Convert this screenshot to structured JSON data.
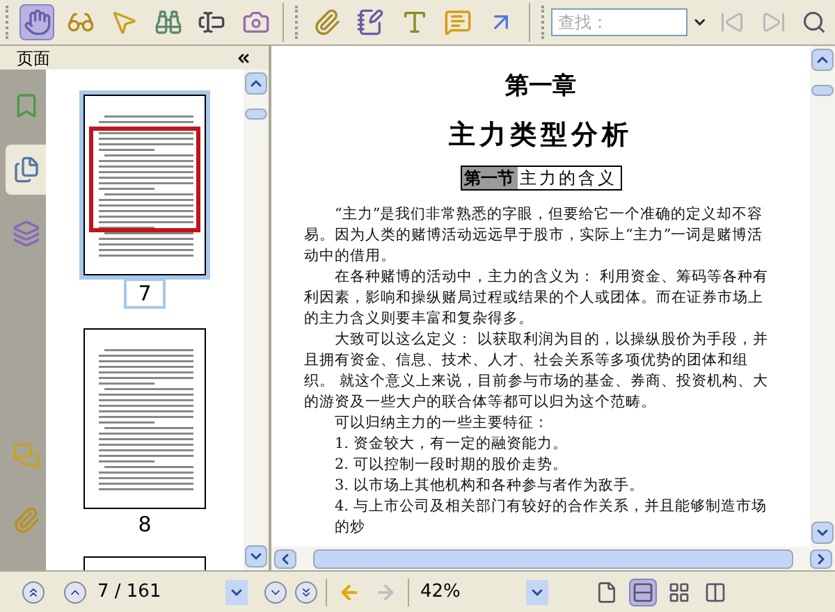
{
  "toolbar": {
    "tools": [
      {
        "kind": "hand",
        "selected": true
      },
      {
        "kind": "glasses",
        "selected": false
      },
      {
        "kind": "pointer",
        "selected": false
      },
      {
        "kind": "binoculars",
        "selected": false
      },
      {
        "kind": "text-select",
        "selected": false
      },
      {
        "kind": "camera",
        "selected": false
      },
      {
        "kind": "attach",
        "selected": false
      },
      {
        "kind": "note",
        "selected": false
      },
      {
        "kind": "textbox",
        "selected": false
      },
      {
        "kind": "comment",
        "selected": false
      },
      {
        "kind": "arrow",
        "selected": false
      }
    ],
    "search": {
      "placeholder": "查找："
    },
    "find_buttons": [
      {
        "kind": "prev",
        "disabled": true
      },
      {
        "kind": "next",
        "disabled": true
      },
      {
        "kind": "search",
        "disabled": false
      }
    ]
  },
  "sidebar": {
    "title": "页面",
    "tabs": [
      {
        "kind": "bookmarks",
        "selected": false
      },
      {
        "kind": "pages",
        "selected": true
      },
      {
        "kind": "layers",
        "selected": false
      },
      {
        "kind": "comments",
        "selected": false
      },
      {
        "kind": "attachments",
        "selected": false
      }
    ],
    "thumbnails": [
      {
        "label": "7",
        "selected": true
      },
      {
        "label": "8",
        "selected": false
      },
      {
        "selected": false
      }
    ]
  },
  "document": {
    "chapter": "第一章",
    "title": "主力类型分析",
    "section": {
      "number": "第一节",
      "title": "主力的含义"
    },
    "paragraphs": [
      {
        "kind": "body",
        "text": "“主力”是我们非常熟悉的字眼，但要给它一个准确的定义却不容易。因为人类的赌博活动远远早于股市，实际上“主力”一词是赌博活动中的借用。"
      },
      {
        "kind": "body",
        "text": "在各种赌博的活动中，主力的含义为： 利用资金、筹码等各种有利因素，影响和操纵赌局过程或结果的个人或团体。而在证券市场上的主力含义则要丰富和复杂得多。"
      },
      {
        "kind": "body",
        "text": "大致可以这么定义： 以获取利润为目的，以操纵股价为手段，并且拥有资金、信息、技术、人才、社会关系等多项优势的团体和组织。 就这个意义上来说，目前参与市场的基金、券商、投资机构、大的游资及一些大户的联合体等都可以归为这个范畴。"
      },
      {
        "kind": "body",
        "text": "可以归纳主力的一些主要特征："
      },
      {
        "kind": "item",
        "text": "1. 资金较大，有一定的融资能力。"
      },
      {
        "kind": "item",
        "text": "2. 可以控制一段时期的股价走势。"
      },
      {
        "kind": "item",
        "text": "3. 以市场上其他机构和各种参与者作为敌手。"
      },
      {
        "kind": "item",
        "text": "4. 与上市公司及相关部门有较好的合作关系，并且能够制造市场的炒"
      }
    ]
  },
  "status_bar": {
    "page_field": "7 / 161",
    "zoom_field": "42%",
    "history": [
      {
        "kind": "back",
        "disabled": false
      },
      {
        "kind": "forward",
        "disabled": true
      }
    ],
    "view_modes": [
      {
        "kind": "single",
        "selected": false
      },
      {
        "kind": "continuous",
        "selected": true
      },
      {
        "kind": "facing",
        "selected": false
      },
      {
        "kind": "continuous-facing",
        "selected": false
      }
    ]
  }
}
